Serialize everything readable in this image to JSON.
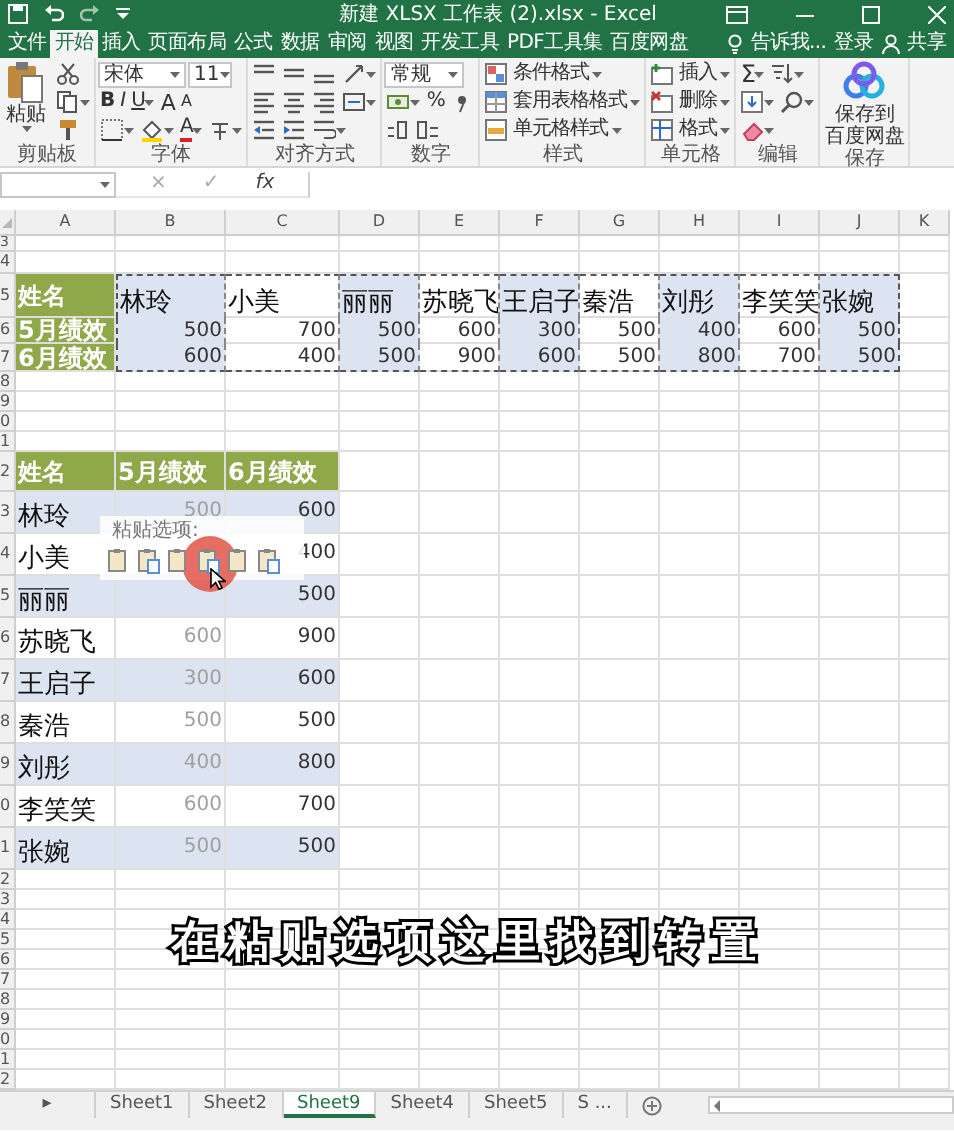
{
  "window": {
    "title": "新建 XLSX 工作表 (2).xlsx - Excel"
  },
  "ribbon_tabs": [
    {
      "label": "文件",
      "selected": false
    },
    {
      "label": "开始",
      "selected": true
    },
    {
      "label": "插入",
      "selected": false
    },
    {
      "label": "页面布局",
      "selected": false
    },
    {
      "label": "公式",
      "selected": false
    },
    {
      "label": "数据",
      "selected": false
    },
    {
      "label": "审阅",
      "selected": false
    },
    {
      "label": "视图",
      "selected": false
    },
    {
      "label": "开发工具",
      "selected": false
    },
    {
      "label": "PDF工具集",
      "selected": false
    },
    {
      "label": "百度网盘",
      "selected": false
    }
  ],
  "tell_me": "告诉我...",
  "sign_in": "登录",
  "share": "共享",
  "ribbon_groups": [
    {
      "label": "剪贴板",
      "columns": [
        [
          [
            {
              "kind": "paste",
              "lines": [
                "粘贴"
              ],
              "dropdown": true
            }
          ]
        ],
        [
          [
            {
              "kind": "cut"
            }
          ],
          [
            {
              "kind": "copy",
              "dropdown": true
            }
          ],
          [
            {
              "kind": "brush"
            }
          ]
        ]
      ]
    },
    {
      "label": "字体",
      "columns": [
        [
          [
            {
              "kind": "font",
              "text": "宋体"
            },
            {
              "kind": "size",
              "text": "11"
            }
          ],
          [
            {
              "kind": "bold",
              "text": "B"
            },
            {
              "kind": "italic",
              "text": "I"
            },
            {
              "kind": "underline",
              "text": "U",
              "dropdown": true
            },
            {
              "kind": "grow",
              "text": "A"
            },
            {
              "kind": "shrink",
              "text": "A"
            }
          ],
          [
            {
              "kind": "border",
              "dropdown": true
            },
            {
              "kind": "fill",
              "dropdown": true
            },
            {
              "kind": "fontcolor",
              "text": "A",
              "dropdown": true
            },
            {
              "kind": "phonetic",
              "dropdown": true
            }
          ]
        ]
      ]
    },
    {
      "label": "对齐方式",
      "columns": [
        [
          [
            {
              "kind": "align-top"
            },
            {
              "kind": "align-middle"
            },
            {
              "kind": "align-bottom"
            },
            {
              "kind": "orientation",
              "dropdown": true
            }
          ],
          [
            {
              "kind": "align-left"
            },
            {
              "kind": "align-center"
            },
            {
              "kind": "align-right"
            },
            {
              "kind": "merge",
              "dropdown": true
            }
          ],
          [
            {
              "kind": "outdent"
            },
            {
              "kind": "indent"
            },
            {
              "kind": "wrap",
              "dropdown": true
            }
          ]
        ]
      ]
    },
    {
      "label": "数字",
      "columns": [
        [
          [
            {
              "kind": "numfmt",
              "text": "常规"
            }
          ],
          [
            {
              "kind": "currency",
              "dropdown": true
            },
            {
              "kind": "percent",
              "text": "%"
            },
            {
              "kind": "comma"
            }
          ],
          [
            {
              "kind": "decimal-more"
            },
            {
              "kind": "decimal-less"
            }
          ]
        ]
      ]
    },
    {
      "label": "样式",
      "columns": [
        [
          [
            {
              "kind": "condfmt",
              "text": "条件格式",
              "dropdown": true
            }
          ],
          [
            {
              "kind": "tablefmt",
              "text": "套用表格格式",
              "dropdown": true
            }
          ],
          [
            {
              "kind": "cellstyle",
              "text": "单元格样式",
              "dropdown": true
            }
          ]
        ]
      ]
    },
    {
      "label": "单元格",
      "columns": [
        [
          [
            {
              "kind": "insert",
              "text": "插入",
              "dropdown": true
            }
          ],
          [
            {
              "kind": "delete",
              "text": "删除",
              "dropdown": true
            }
          ],
          [
            {
              "kind": "format",
              "text": "格式",
              "dropdown": true
            }
          ]
        ]
      ]
    },
    {
      "label": "编辑",
      "columns": [
        [
          [
            {
              "kind": "sum",
              "text": "Σ",
              "dropdown": true
            },
            {
              "kind": "sort",
              "dropdown": true
            }
          ],
          [
            {
              "kind": "fillcell",
              "dropdown": true
            },
            {
              "kind": "find",
              "dropdown": true
            }
          ],
          [
            {
              "kind": "clear",
              "dropdown": true
            }
          ]
        ]
      ]
    },
    {
      "label": "保存",
      "columns": [
        [
          [
            {
              "kind": "cloud",
              "lines": [
                "保存到",
                "百度网盘"
              ]
            }
          ]
        ]
      ]
    }
  ],
  "formula_bar": {
    "buttons": [
      "×",
      "✓",
      "fx"
    ]
  },
  "sheet": {
    "column_headers": [
      "A",
      "B",
      "C",
      "D",
      "E",
      "F",
      "G",
      "H",
      "I",
      "J",
      "K"
    ],
    "row_numbers": [
      "3",
      "4",
      "5",
      "6",
      "7",
      "8",
      "9",
      "0",
      "1",
      "2",
      "3",
      "4",
      "5",
      "6",
      "7",
      "8",
      "9",
      "0",
      "1",
      "2",
      "3",
      "4",
      "5",
      "6",
      "7",
      "8",
      "9",
      "0",
      "1",
      "2"
    ],
    "transposed_table": {
      "headers": [
        "姓名",
        "5月绩效",
        "6月绩效"
      ],
      "columns": [
        {
          "name": "林玲",
          "may": "500",
          "june": "600",
          "shaded": true
        },
        {
          "name": "小美",
          "may": "700",
          "june": "400",
          "shaded": false
        },
        {
          "name": "丽丽",
          "may": "500",
          "june": "500",
          "shaded": true
        },
        {
          "name": "苏晓飞",
          "may": "600",
          "june": "900",
          "shaded": false
        },
        {
          "name": "王启子",
          "may": "300",
          "june": "600",
          "shaded": true
        },
        {
          "name": "秦浩",
          "may": "500",
          "june": "500",
          "shaded": false
        },
        {
          "name": "刘彤",
          "may": "400",
          "june": "800",
          "shaded": true
        },
        {
          "name": "李笑笑",
          "may": "600",
          "june": "700",
          "shaded": false
        },
        {
          "name": "张婉",
          "may": "500",
          "june": "500",
          "shaded": true
        }
      ]
    },
    "source_table": {
      "headers": [
        "姓名",
        "5月绩效",
        "6月绩效"
      ],
      "rows": [
        {
          "name": "林玲",
          "may": "500",
          "june": "600",
          "shaded": true
        },
        {
          "name": "小美",
          "may": null,
          "june": "400",
          "shaded": false
        },
        {
          "name": "丽丽",
          "may": null,
          "june": "500",
          "shaded": true
        },
        {
          "name": "苏晓飞",
          "may": "600",
          "june": "900",
          "shaded": false
        },
        {
          "name": "王启子",
          "may": "300",
          "june": "600",
          "shaded": true
        },
        {
          "name": "秦浩",
          "may": "500",
          "june": "500",
          "shaded": false
        },
        {
          "name": "刘彤",
          "may": "400",
          "june": "800",
          "shaded": true
        },
        {
          "name": "李笑笑",
          "may": "600",
          "june": "700",
          "shaded": false
        },
        {
          "name": "张婉",
          "may": "500",
          "june": "500",
          "shaded": true
        }
      ]
    }
  },
  "paste_options": {
    "title": "粘贴选项:"
  },
  "caption": "在粘贴选项这里找到转置",
  "sheet_tabs": {
    "nav": "▸",
    "tabs": [
      {
        "label": "Sheet1",
        "selected": false
      },
      {
        "label": "Sheet2",
        "selected": false
      },
      {
        "label": "Sheet9",
        "selected": true
      },
      {
        "label": "Sheet4",
        "selected": false
      },
      {
        "label": "Sheet5",
        "selected": false
      },
      {
        "label": "S ...",
        "selected": false
      }
    ]
  }
}
